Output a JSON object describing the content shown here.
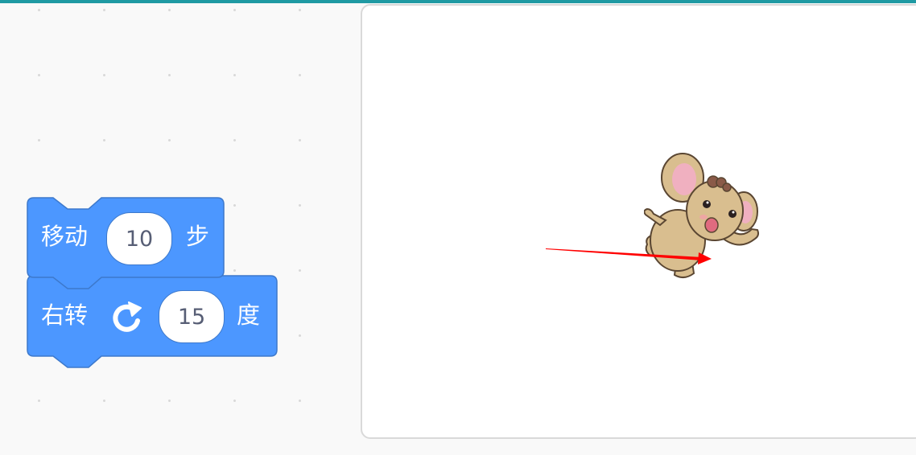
{
  "colors": {
    "top_accent": "#1f9aa3",
    "block_fill": "#4c97ff",
    "block_stroke": "#3d79cc",
    "direction_arrow": "#ff0000"
  },
  "script": {
    "move_block": {
      "label": "移动",
      "steps": "10",
      "unit": "步"
    },
    "turn_block": {
      "label": "右转",
      "icon": "rotate-right-icon",
      "degrees": "15",
      "unit": "度"
    }
  },
  "stage": {
    "sprite": {
      "icon": "elephant-sprite",
      "direction_indicator": "direction-arrow"
    }
  }
}
